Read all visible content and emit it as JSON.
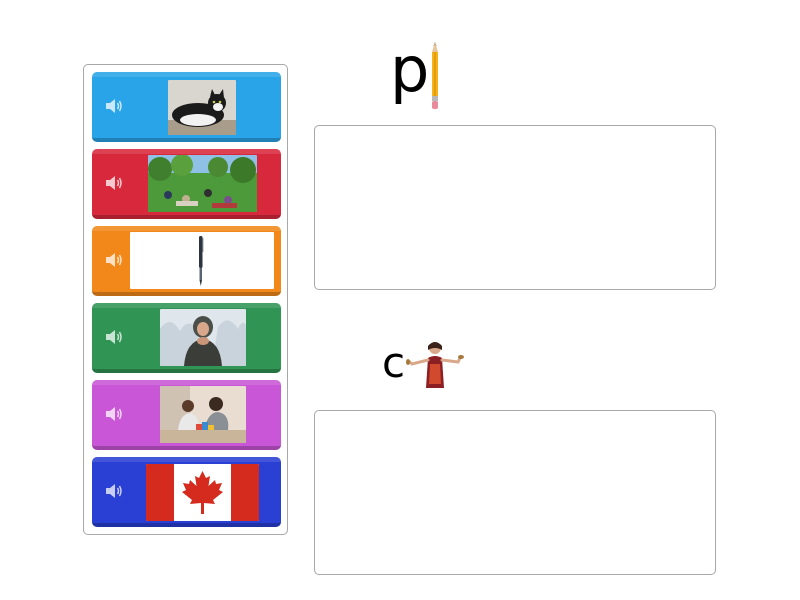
{
  "groups": [
    {
      "letter": "p",
      "icon": "pencil-icon"
    },
    {
      "letter": "c",
      "icon": "chef-icon"
    }
  ],
  "cards": [
    {
      "name": "card-cat",
      "color": "#2aa4e8",
      "image": "cat-picture"
    },
    {
      "name": "card-picnic",
      "color": "#d8283c",
      "image": "picnic-picture"
    },
    {
      "name": "card-pen",
      "color": "#f2881a",
      "image": "pen-picture"
    },
    {
      "name": "card-cold",
      "color": "#2f9454",
      "image": "cold-person-picture"
    },
    {
      "name": "card-play",
      "color": "#c956d6",
      "image": "children-playing-picture"
    },
    {
      "name": "card-canada",
      "color": "#2a3fd4",
      "image": "canada-flag-picture"
    }
  ],
  "colors": {
    "zone_border": "#a8a8a8",
    "flag_red": "#d52b1e"
  }
}
